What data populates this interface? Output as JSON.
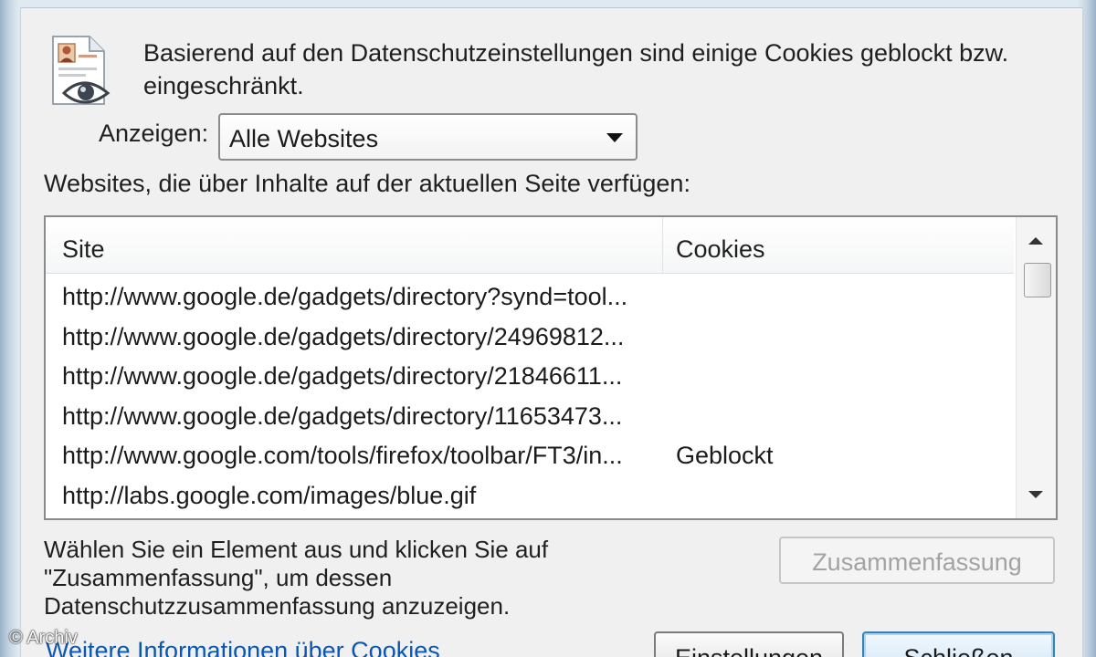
{
  "intro_text": "Basierend auf den Datenschutzeinstellungen sind einige Cookies geblockt bzw. eingeschränkt.",
  "show": {
    "label": "Anzeigen:",
    "selected": "Alle Websites"
  },
  "list_caption": "Websites, die über Inhalte auf der aktuellen Seite verfügen:",
  "table": {
    "columns": [
      "Site",
      "Cookies"
    ],
    "rows": [
      {
        "site": "http://www.google.de/gadgets/directory?synd=tool...",
        "cookies": ""
      },
      {
        "site": "http://www.google.de/gadgets/directory/24969812...",
        "cookies": ""
      },
      {
        "site": "http://www.google.de/gadgets/directory/21846611...",
        "cookies": ""
      },
      {
        "site": "http://www.google.de/gadgets/directory/11653473...",
        "cookies": ""
      },
      {
        "site": "http://www.google.com/tools/firefox/toolbar/FT3/in...",
        "cookies": "Geblockt"
      },
      {
        "site": "http://labs.google.com/images/blue.gif",
        "cookies": ""
      }
    ]
  },
  "help_text_lines": [
    "Wählen Sie ein Element aus und klicken Sie auf",
    "\"Zusammenfassung\", um dessen",
    "Datenschutzzusammenfassung anzuzeigen."
  ],
  "buttons": {
    "summary": "Zusammenfassung",
    "settings": "Einstellungen",
    "close": "Schließen"
  },
  "more_info_link": "Weitere Informationen über Cookies",
  "watermark": "© Archiv",
  "colors": {
    "link": "#0a56b3",
    "disabled_text": "#a3a3a3",
    "default_button_border": "#3c7fb1"
  },
  "icons": {
    "dialog": "privacy-report-document-eye-icon",
    "dropdown": "dropdown-arrow-icon",
    "scroll_up": "scroll-up-arrow-icon",
    "scroll_down": "scroll-down-arrow-icon"
  }
}
